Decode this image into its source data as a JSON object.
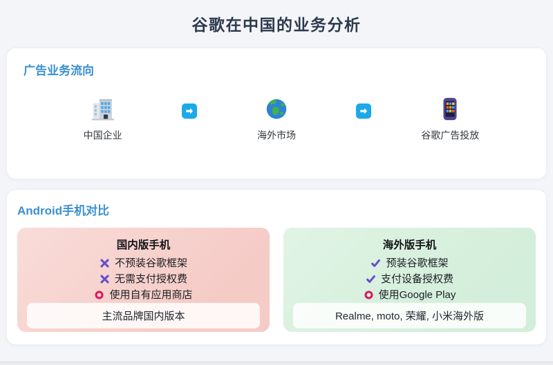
{
  "page": {
    "title": "谷歌在中国的业务分析",
    "background_color": "#f4f5f9",
    "title_color": "#2d3a4d",
    "heading_color": "#3a90ce"
  },
  "ad_flow": {
    "heading": "广告业务流向",
    "steps": [
      {
        "icon": "office-building-icon",
        "label": "中国企业"
      },
      {
        "icon": "globe-icon",
        "label": "海外市场"
      },
      {
        "icon": "smartphone-apps-icon",
        "label": "谷歌广告投放"
      }
    ],
    "arrow_icon": "arrow-right-icon",
    "arrow_color": "#1ca9e8"
  },
  "android_compare": {
    "heading": "Android手机对比",
    "panels": [
      {
        "title": "国内版手机",
        "theme_color": "#f5cbc6",
        "items": [
          {
            "mark": "cross-icon",
            "text": "不预装谷歌框架"
          },
          {
            "mark": "cross-icon",
            "text": "无需支付授权费"
          },
          {
            "mark": "circle-icon",
            "text": "使用自有应用商店"
          }
        ],
        "footer": "主流品牌国内版本"
      },
      {
        "title": "海外版手机",
        "theme_color": "#d3eeda",
        "items": [
          {
            "mark": "check-icon",
            "text": "预装谷歌框架"
          },
          {
            "mark": "check-icon",
            "text": "支付设备授权费"
          },
          {
            "mark": "circle-icon",
            "text": "使用Google Play"
          }
        ],
        "footer": "Realme, moto, 荣耀, 小米海外版"
      }
    ],
    "mark_colors": {
      "cross": "#6152c9",
      "check": "#6152c9",
      "circle": "#d81b60"
    }
  }
}
